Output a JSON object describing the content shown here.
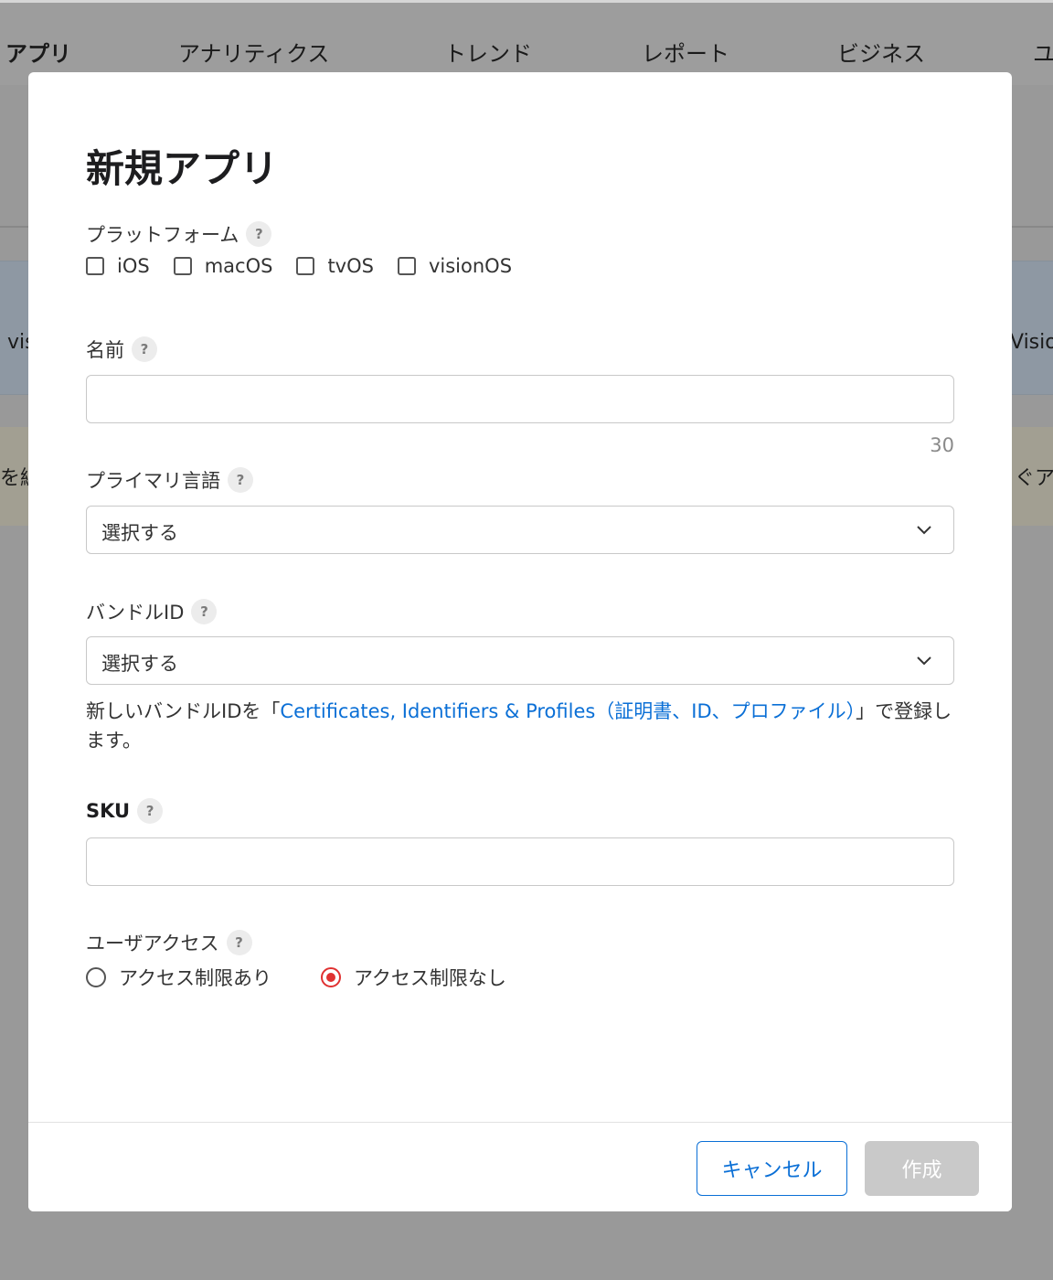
{
  "background": {
    "nav": [
      "アプリ",
      "アナリティクス",
      "トレンド",
      "レポート",
      "ビジネス",
      "ユ"
    ],
    "fragments": {
      "left_card": "vis",
      "right_card": "Visio",
      "left_banner": "を編",
      "right_banner": "ぐア"
    }
  },
  "modal": {
    "title": "新規アプリ",
    "help_icon_text": "?",
    "platform": {
      "label": "プラットフォーム",
      "options": [
        "iOS",
        "macOS",
        "tvOS",
        "visionOS"
      ]
    },
    "name": {
      "label": "名前",
      "value": "",
      "counter": "30"
    },
    "primary_language": {
      "label": "プライマリ言語",
      "selected": "選択する"
    },
    "bundle_id": {
      "label": "バンドルID",
      "selected": "選択する",
      "note_prefix": "新しいバンドルIDを「",
      "note_link": "Certificates, Identifiers & Profiles（証明書、ID、プロファイル）",
      "note_suffix": "」で登録します。"
    },
    "sku": {
      "label": "SKU",
      "value": ""
    },
    "user_access": {
      "label": "ユーザアクセス",
      "options": [
        "アクセス制限あり",
        "アクセス制限なし"
      ],
      "selected_index": 1
    },
    "buttons": {
      "cancel": "キャンセル",
      "create": "作成"
    }
  },
  "colors": {
    "accent": "#0a6fd6",
    "radio_selected": "#e03131",
    "disabled_button": "#c9c9c9"
  }
}
